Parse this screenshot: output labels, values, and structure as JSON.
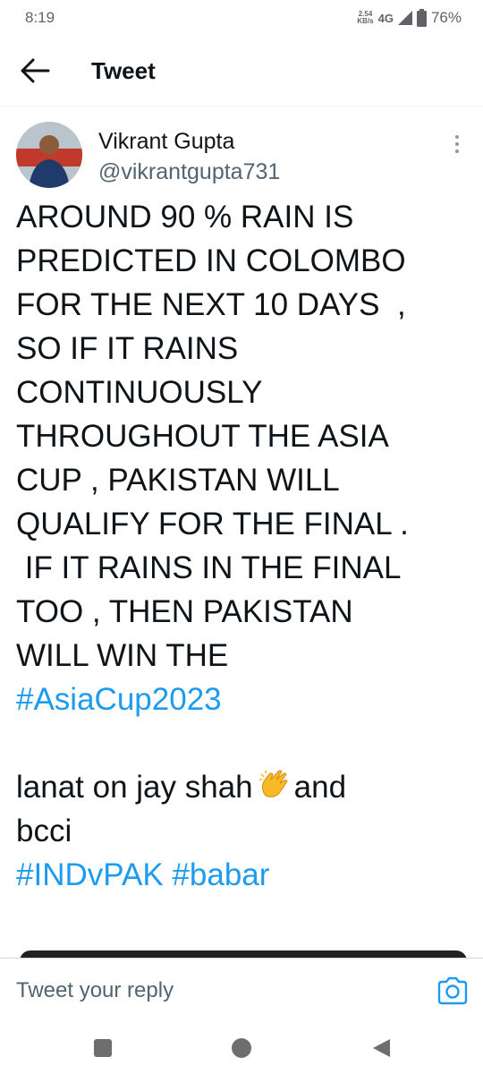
{
  "status_bar": {
    "time": "8:19",
    "net_speed_value": "2.54",
    "net_speed_unit": "KB/s",
    "network_type": "4G",
    "battery": "76%"
  },
  "app_bar": {
    "title": "Tweet"
  },
  "tweet": {
    "author_name": "Vikrant Gupta",
    "author_handle": "@vikrantgupta731",
    "lines": [
      "AROUND 90 % RAIN IS",
      "PREDICTED IN COLOMBO",
      "FOR THE NEXT 10 DAYS  ,",
      "SO IF IT RAINS",
      "CONTINUOUSLY",
      "THROUGHOUT THE ASIA",
      "CUP , PAKISTAN WILL",
      "QUALIFY FOR THE FINAL .",
      " IF IT RAINS IN THE FINAL",
      "TOO , THEN PAKISTAN",
      "WILL WIN THE"
    ],
    "hashtag_asiacup": "#AsiaCup2023",
    "comment_start": "lanat on jay shah",
    "comment_end": "and",
    "comment_line2": "bcci",
    "hashtag_indvpak": "#INDvPAK",
    "hashtag_babar": "#babar"
  },
  "reply": {
    "placeholder": "Tweet your reply"
  },
  "colors": {
    "link": "#1d9bf0",
    "text_primary": "#0f1419",
    "text_secondary": "#536471"
  },
  "icons": {
    "back": "arrow-left-icon",
    "more": "more-vertical-icon",
    "emoji": "clapping-hands-icon",
    "camera": "camera-icon",
    "signal": "signal-icon",
    "battery": "battery-icon"
  }
}
